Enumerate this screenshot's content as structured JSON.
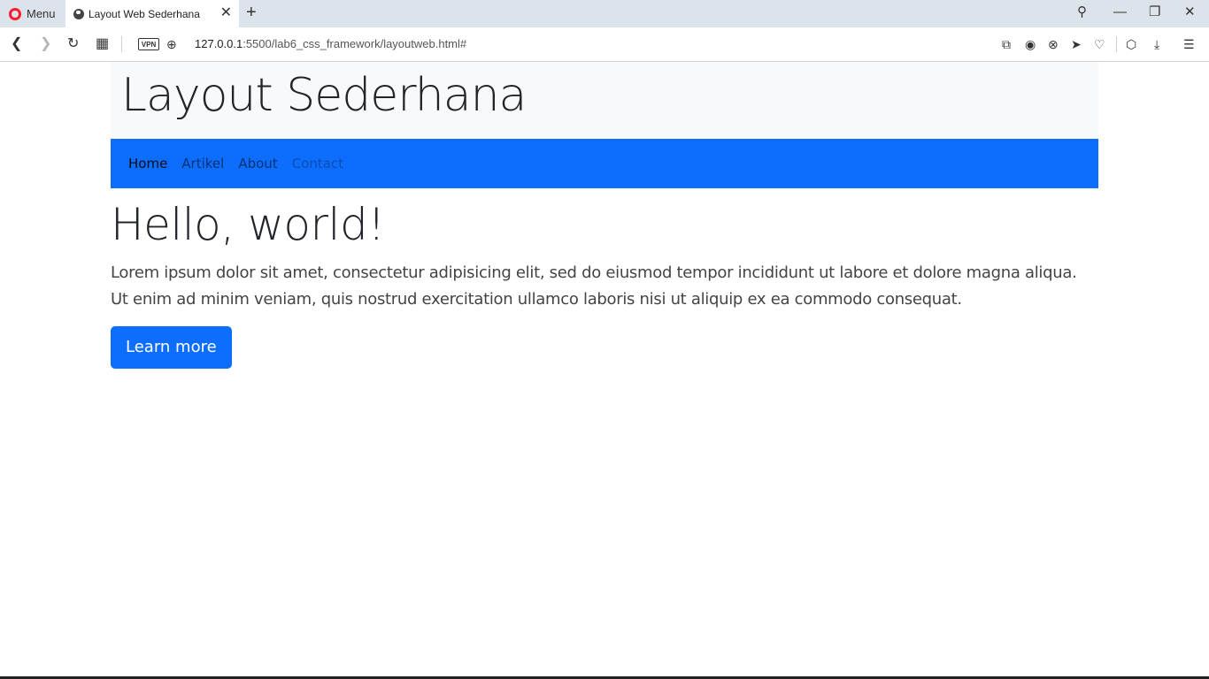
{
  "browser": {
    "menu_label": "Menu",
    "tab_title": "Layout Web Sederhana",
    "tab_close": "✕",
    "new_tab": "+",
    "url_host": "127.0.0.1",
    "url_path": ":5500/lab6_css_framework/layoutweb.html#",
    "vpn_label": "VPN",
    "icons": {
      "back": "❮",
      "forward": "❯",
      "reload": "↻",
      "tabs": "▦",
      "search": "⚲",
      "minimize": "—",
      "restore": "❐",
      "close": "✕",
      "snapshot": "⧉",
      "camera": "◉",
      "blocker": "⊗",
      "send": "➤",
      "heart": "♡",
      "box": "⬡",
      "download": "⤓",
      "settings": "☰"
    }
  },
  "page": {
    "header_title": "Layout Sederhana",
    "nav": [
      "Home",
      "Artikel",
      "About",
      "Contact"
    ],
    "hero_title": "Hello, world!",
    "hero_text": "Lorem ipsum dolor sit amet, consectetur adipisicing elit, sed do eiusmod tempor incididunt ut labore et dolore magna aliqua. Ut enim ad minim veniam, quis nostrud exercitation ullamco laboris nisi ut aliquip ex ea commodo consequat.",
    "button_label": "Learn more"
  },
  "colors": {
    "nav_bg": "#0d6efd",
    "header_bg": "#f8f9fa",
    "button_bg": "#0d6efd"
  }
}
